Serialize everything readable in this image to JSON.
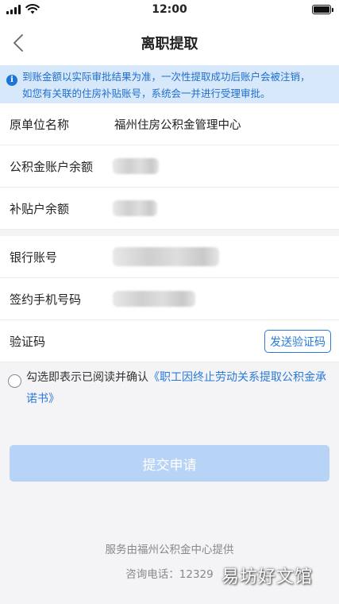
{
  "status_bar": {
    "time": "12:00"
  },
  "nav": {
    "title": "离职提取",
    "back_icon": "chevron-left-icon"
  },
  "notice": {
    "icon": "info-icon",
    "icon_glyph": "i",
    "line1": "到账金额以实际审批结果为准，一次性提取成功后账户会被注销，",
    "line2": "如您有关联的住房补贴账号，系统会一并进行受理审批。"
  },
  "form": {
    "employer_label": "原单位名称",
    "employer_value": "福州住房公积金管理中心",
    "fund_balance_label": "公积金账户余额",
    "subsidy_balance_label": "补贴户余额",
    "bank_account_label": "银行账号",
    "phone_label": "签约手机号码",
    "code_label": "验证码",
    "send_code_button": "发送验证码"
  },
  "agreement": {
    "prefix": "勾选即表示已阅读并确认",
    "link": "《职工因终止劳动关系提取公积金承诺书》"
  },
  "submit_button": "提交申请",
  "footer": {
    "service_text": "服务由福州公积金中心提供",
    "hotline_text": "咨询电话：12329"
  },
  "watermark": "易坊好文馆",
  "colors": {
    "accent": "#2a7ad8",
    "notice_bg": "#d7e8fb",
    "submit_disabled": "#b7d3f5",
    "page_bg": "#f4f4f6"
  }
}
